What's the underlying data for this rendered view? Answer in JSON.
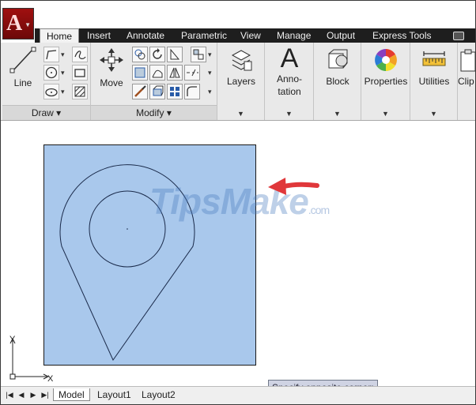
{
  "app": {
    "menu_icon": "autocad-app-icon",
    "logo_letter": "A"
  },
  "ribbon_tabs": [
    "Home",
    "Insert",
    "Annotate",
    "Parametric",
    "View",
    "Manage",
    "Output",
    "Express Tools"
  ],
  "active_tab": "Home",
  "panels": {
    "draw": {
      "title": "Draw",
      "line_label": "Line"
    },
    "modify": {
      "title": "Modify",
      "move_label": "Move"
    },
    "layers": {
      "label": "Layers"
    },
    "annotation": {
      "label": "Anno-\ntation",
      "glyph": "A"
    },
    "block": {
      "label": "Block"
    },
    "properties": {
      "label": "Properties"
    },
    "utilities": {
      "label": "Utilities"
    },
    "clipboard": {
      "label": "Clip"
    }
  },
  "drawing": {
    "watermark": "TipsMake",
    "watermark_suffix": ".com",
    "ucs_x": "X",
    "ucs_y": "Y",
    "arrow_color": "#e0373a",
    "selection_color": "#a9c8ec"
  },
  "layout_tabs": [
    "Model",
    "Layout1",
    "Layout2"
  ],
  "active_layout": "Model",
  "command_prompt": "Specify opposite corner:"
}
